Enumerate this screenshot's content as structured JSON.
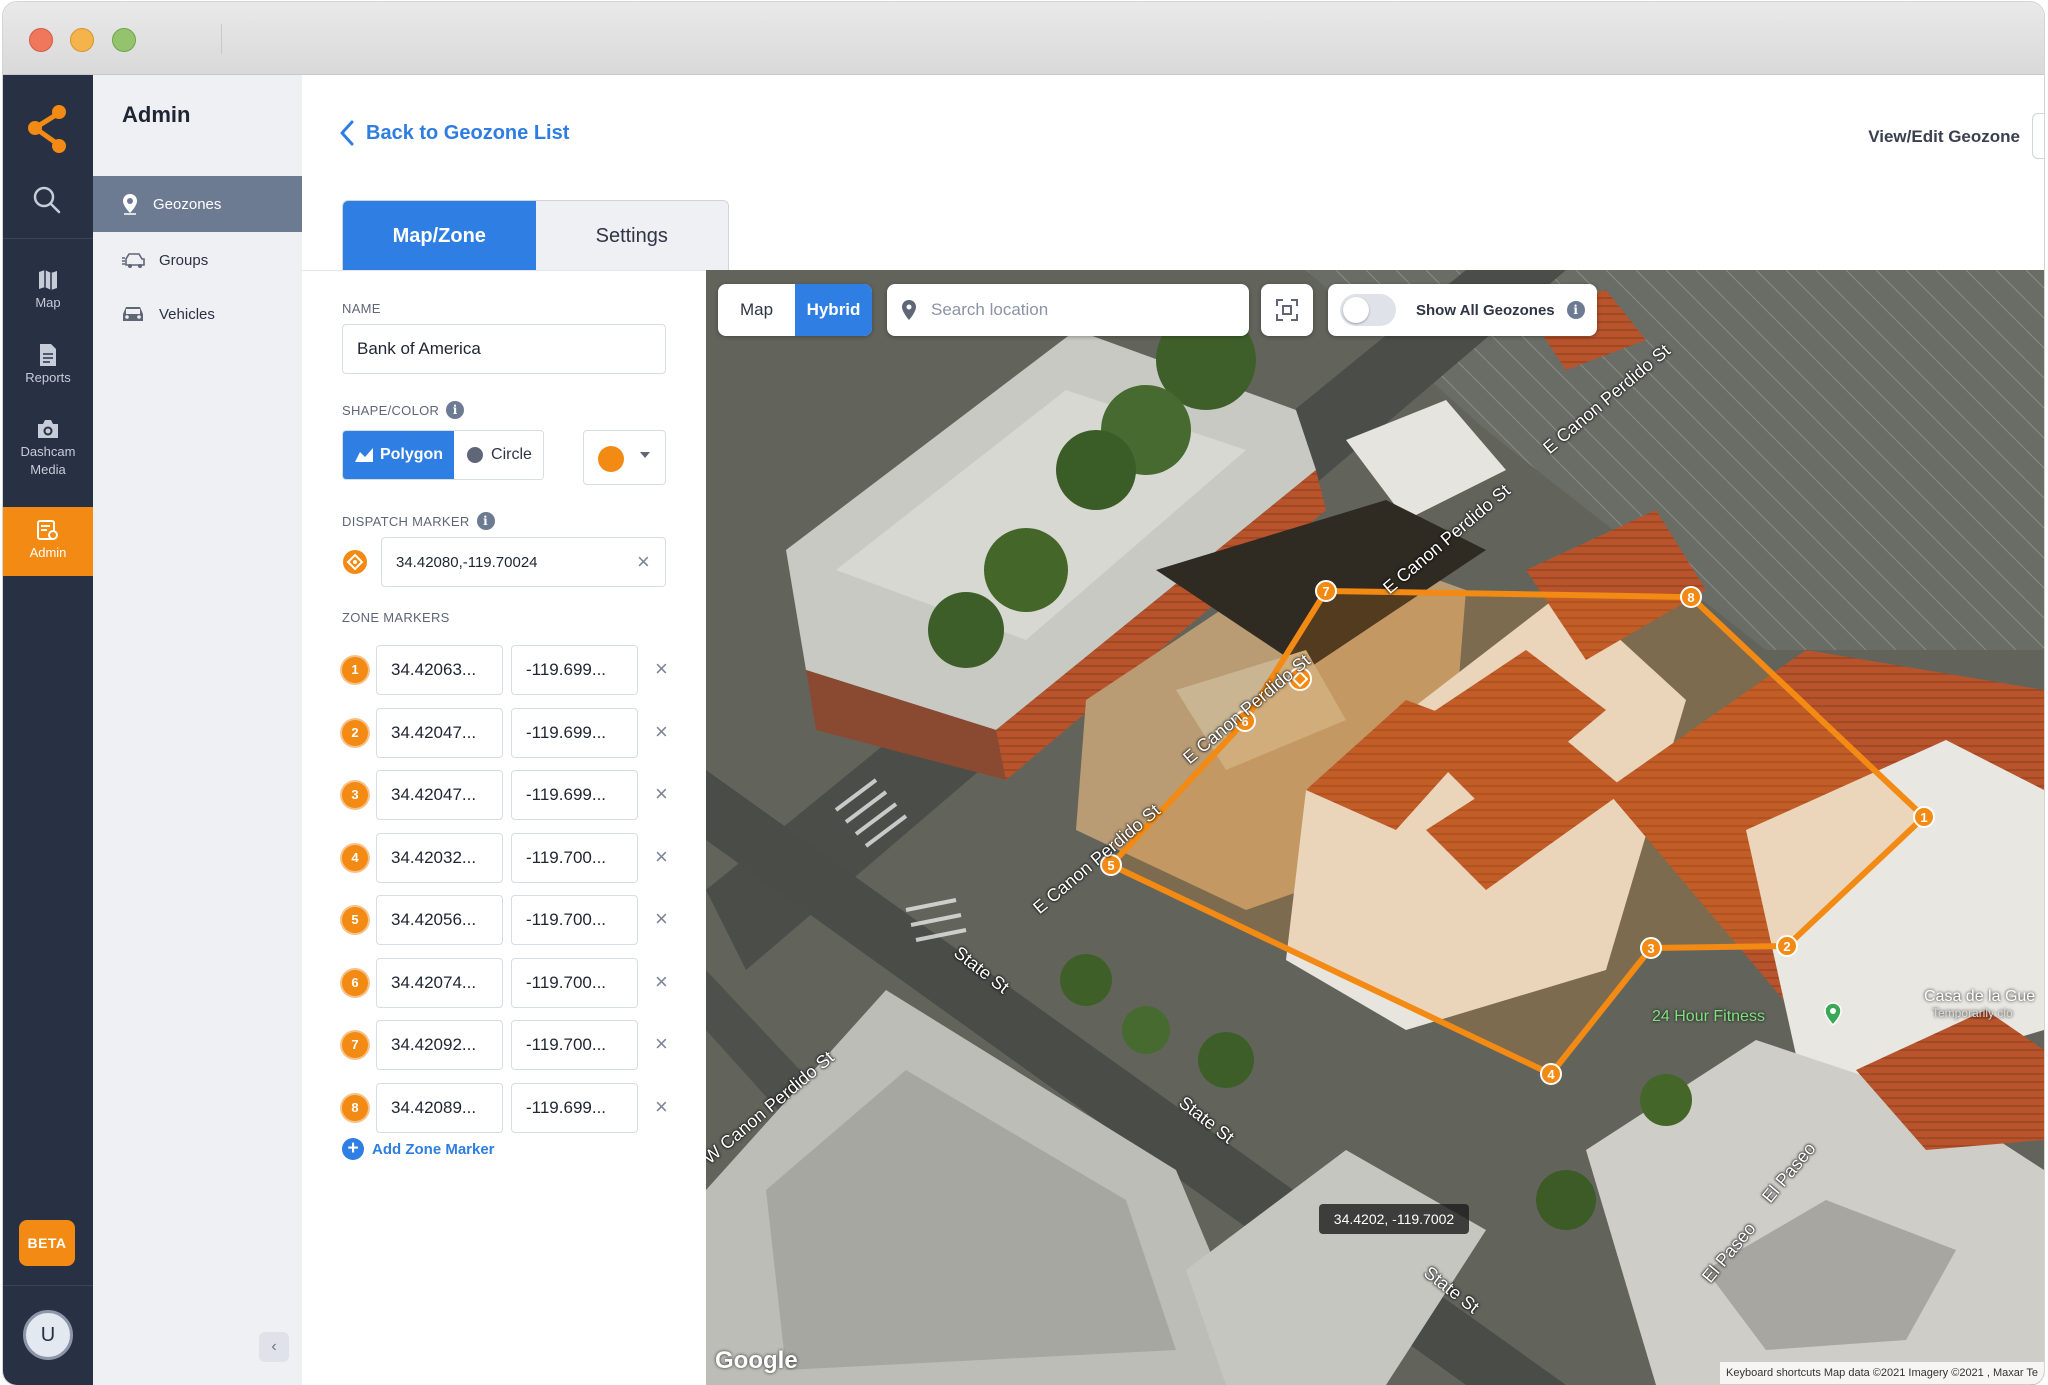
{
  "nav_rail": {
    "items": [
      {
        "label": "Map",
        "icon": "map-icon"
      },
      {
        "label": "Reports",
        "icon": "document-icon"
      },
      {
        "label": "Dashcam Media",
        "icon": "camera-icon"
      },
      {
        "label": "Admin",
        "icon": "admin-icon"
      }
    ],
    "beta_label": "BETA",
    "avatar_initial": "U"
  },
  "subnav": {
    "title": "Admin",
    "items": [
      {
        "label": "Geozones",
        "icon": "pin-icon"
      },
      {
        "label": "Groups",
        "icon": "cars-icon"
      },
      {
        "label": "Vehicles",
        "icon": "car-icon"
      }
    ]
  },
  "header": {
    "back_label": "Back to Geozone List",
    "view_edit_label": "View/Edit Geozone"
  },
  "tabs": [
    {
      "label": "Map/Zone"
    },
    {
      "label": "Settings"
    }
  ],
  "form": {
    "name_label": "NAME",
    "name_value": "Bank of America",
    "shape_label": "SHAPE/COLOR",
    "shape_options": [
      {
        "label": "Polygon"
      },
      {
        "label": "Circle"
      }
    ],
    "color": "#f28a14",
    "dispatch_label": "DISPATCH MARKER",
    "dispatch_value": "34.42080,-119.70024",
    "zone_label": "ZONE MARKERS",
    "zone_markers": [
      {
        "num": "1",
        "lat": "34.42063...",
        "lng": "-119.699..."
      },
      {
        "num": "2",
        "lat": "34.42047...",
        "lng": "-119.699..."
      },
      {
        "num": "3",
        "lat": "34.42047...",
        "lng": "-119.699..."
      },
      {
        "num": "4",
        "lat": "34.42032...",
        "lng": "-119.700..."
      },
      {
        "num": "5",
        "lat": "34.42056...",
        "lng": "-119.700..."
      },
      {
        "num": "6",
        "lat": "34.42074...",
        "lng": "-119.700..."
      },
      {
        "num": "7",
        "lat": "34.42092...",
        "lng": "-119.700..."
      },
      {
        "num": "8",
        "lat": "34.42089...",
        "lng": "-119.699..."
      }
    ],
    "add_label": "Add Zone Marker",
    "info_glyph": "i",
    "clear_glyph": "×"
  },
  "map": {
    "mode_options": [
      {
        "label": "Map"
      },
      {
        "label": "Hybrid"
      }
    ],
    "search_placeholder": "Search location",
    "show_all_label": "Show All Geozones",
    "tooltip": "34.4202, -119.7002",
    "brand": "Google",
    "attribution": "Keyboard shortcuts   Map data ©2021 Imagery ©2021 , Maxar Te",
    "streets": [
      "E Canon Perdido St",
      "E Canon Perdido St",
      "E Canon Perdido St",
      "E Canon Perdido St",
      "State St",
      "State St",
      "State St",
      "W Canon Perdido St",
      "El Paseo",
      "El Paseo"
    ],
    "pois": [
      "24 Hour Fitness",
      "Casa de la Gue",
      "Temporarily clo"
    ],
    "polygon_color": "#f28a14"
  }
}
